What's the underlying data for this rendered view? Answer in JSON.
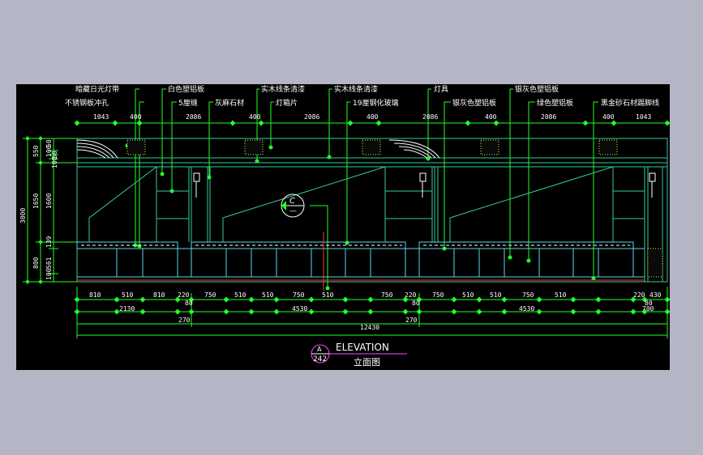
{
  "colors": {
    "background_outer": "#b4b6c6",
    "canvas": "#000000",
    "outline": "#33cc99",
    "cabinet": "#5ad7e6",
    "leader": "#22ff22",
    "dim_line": "#22ff22",
    "text": "#ffffff",
    "hatch": "#ccff33",
    "baseline": "#ff3333",
    "symbol": "#ff44ff"
  },
  "annotations": {
    "top_row": [
      "暗藏日光灯带",
      "白色塑铝板",
      "实木线条清漆",
      "实木线条清漆",
      "灯具",
      "银灰色塑铝板"
    ],
    "second_row": [
      "不锈钢板冲孔",
      "5厘缝",
      "灰麻石材",
      "灯箱片",
      "19厘钢化玻璃",
      "银灰色塑铝板",
      "绿色塑铝板",
      "黑金砂石材踢脚线"
    ]
  },
  "dims": {
    "top": [
      "1043",
      "400",
      "2086",
      "400",
      "2086",
      "400",
      "2086",
      "400",
      "2086",
      "400",
      "1043"
    ],
    "left_outer": [
      "3000"
    ],
    "left_mid": [
      "550",
      "1650",
      "800"
    ],
    "left_inner": [
      "50",
      "100",
      "50",
      "100",
      "1600",
      "139",
      "561",
      "100"
    ],
    "bottom_row1": [
      "810",
      "510",
      "810",
      "220",
      "750",
      "510",
      "510",
      "750",
      "510",
      "750",
      "220",
      "750",
      "510",
      "510",
      "750",
      "510",
      "220",
      "430"
    ],
    "bottom_row2_small": [
      "80",
      "80",
      "80"
    ],
    "bottom_row2": [
      "2130",
      "4530",
      "4530",
      "700"
    ],
    "bottom_row3": [
      "270",
      "270"
    ],
    "total": "12430"
  },
  "section_marker": {
    "letter": "C",
    "sub": "—"
  },
  "title_block": {
    "ref_top": "A",
    "ref_bottom": "242",
    "title": "ELEVATION",
    "subtitle": "立面图"
  }
}
